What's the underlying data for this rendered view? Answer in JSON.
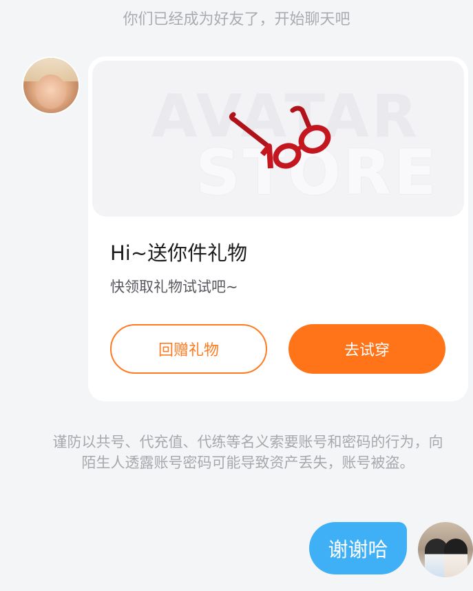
{
  "system_notice": "你们已经成为好友了，开始聊天吧",
  "gift_card": {
    "watermark_line1": "AVATAR",
    "watermark_line2": "STORE",
    "title": "Hi~送你件礼物",
    "subtitle": "快领取礼物试试吧~",
    "return_gift_label": "回赠礼物",
    "try_on_label": "去试穿",
    "item_icon": "glasses-icon"
  },
  "security_warning": "谨防以共号、代充值、代练等名义索要账号和密码的行为，向陌生人透露账号密码可能导致资产丢失，账号被盗。",
  "self_message": "谢谢哈",
  "colors": {
    "accent_orange": "#ff7418",
    "bubble_blue": "#3fb0f5",
    "background": "#f4f5f7"
  }
}
